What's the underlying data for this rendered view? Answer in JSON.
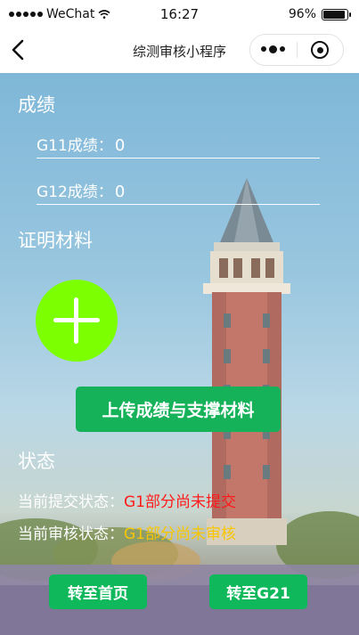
{
  "status_bar": {
    "carrier": "WeChat",
    "time": "16:27",
    "battery": "96%"
  },
  "nav": {
    "title": "综测审核小程序"
  },
  "scores": {
    "section_title": "成绩",
    "g11_label": "G11成绩：",
    "g11_value": "0",
    "g12_label": "G12成绩：",
    "g12_value": "0"
  },
  "materials": {
    "section_title": "证明材料",
    "upload_label": "上传成绩与支撑材料"
  },
  "status": {
    "section_title": "状态",
    "submit_label": "当前提交状态：",
    "submit_value": "G1部分尚未提交",
    "review_label": "当前审核状态：",
    "review_value": "G1部分尚未审核"
  },
  "footer": {
    "home_label": "转至首页",
    "g21_label": "转至G21"
  },
  "colors": {
    "accent_green": "#19b356",
    "add_green": "#7cff00",
    "status_red": "#ff1a1a",
    "status_yellow": "#f7c600"
  }
}
